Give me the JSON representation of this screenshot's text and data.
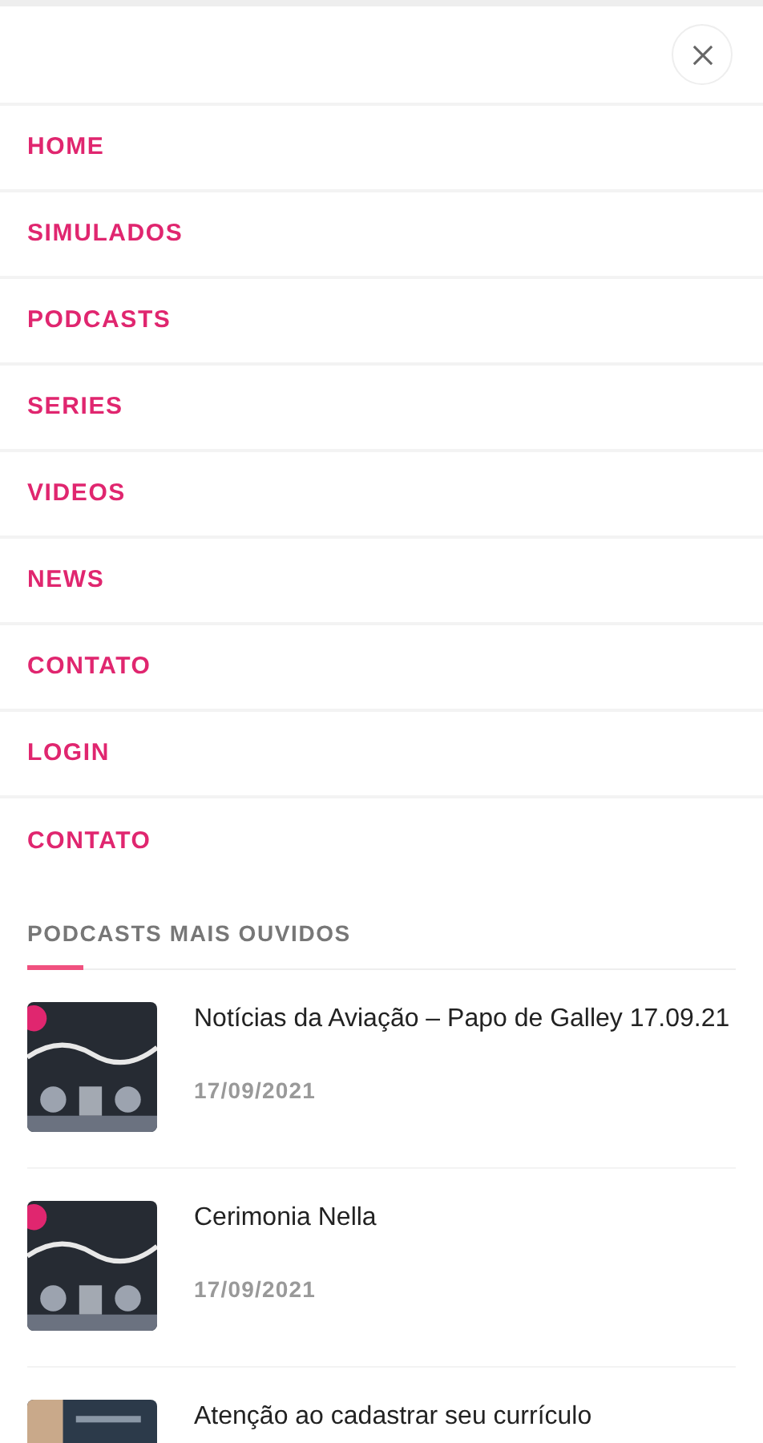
{
  "menu": [
    {
      "label": "HOME"
    },
    {
      "label": "SIMULADOS"
    },
    {
      "label": "PODCASTS"
    },
    {
      "label": "SERIES"
    },
    {
      "label": "VIDEOS"
    },
    {
      "label": "NEWS"
    },
    {
      "label": "CONTATO"
    },
    {
      "label": "LOGIN"
    },
    {
      "label": "CONTATO"
    }
  ],
  "section": {
    "title": "PODCASTS MAIS OUVIDOS"
  },
  "podcasts": [
    {
      "title": "Notícias da Aviação – Papo de Galley 17.09.21",
      "date": "17/09/2021"
    },
    {
      "title": "Cerimonia Nella",
      "date": "17/09/2021"
    },
    {
      "title": "Atenção ao cadastrar seu currículo"
    }
  ]
}
